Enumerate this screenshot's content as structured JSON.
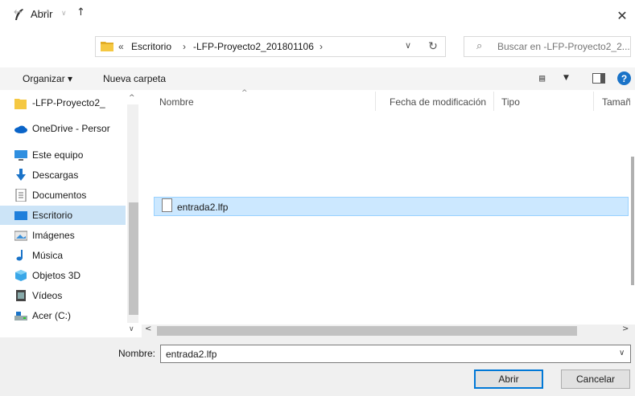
{
  "window": {
    "title": "Abrir"
  },
  "address": {
    "chevrons": "«",
    "crumbs": [
      "Escritorio",
      "-LFP-Proyecto2_201801106"
    ],
    "separator": "›"
  },
  "search": {
    "placeholder": "Buscar en -LFP-Proyecto2_2..."
  },
  "toolbar": {
    "organizar": "Organizar ▾",
    "nueva_carpeta": "Nueva carpeta"
  },
  "sidebar": {
    "items": [
      {
        "label": "-LFP-Proyecto2_",
        "icon": "folder-icon"
      },
      {
        "label": "OneDrive - Persor",
        "icon": "cloud-icon"
      },
      {
        "label": "Este equipo",
        "icon": "computer-icon"
      },
      {
        "label": "Descargas",
        "icon": "download-icon"
      },
      {
        "label": "Documentos",
        "icon": "document-icon"
      },
      {
        "label": "Escritorio",
        "icon": "desktop-icon",
        "selected": true
      },
      {
        "label": "Imágenes",
        "icon": "pictures-icon"
      },
      {
        "label": "Música",
        "icon": "music-icon"
      },
      {
        "label": "Objetos 3D",
        "icon": "cube-icon"
      },
      {
        "label": "Vídeos",
        "icon": "video-icon"
      },
      {
        "label": "Acer (C:)",
        "icon": "drive-icon"
      }
    ]
  },
  "columns": {
    "nombre": "Nombre",
    "fecha": "Fecha de modificación",
    "tipo": "Tipo",
    "tamano": "Tamañ"
  },
  "files": [
    {
      "name": "entrada2.lfp"
    }
  ],
  "footer": {
    "nombre_label": "Nombre:",
    "nombre_value": "entrada2.lfp",
    "open_button": "Abrir",
    "cancel_button": "Cancelar"
  },
  "colors": {
    "selection": "#cce8ff",
    "sidebar_selection": "#cce4f7",
    "accent": "#0078d7",
    "folder": "#f5c842"
  }
}
